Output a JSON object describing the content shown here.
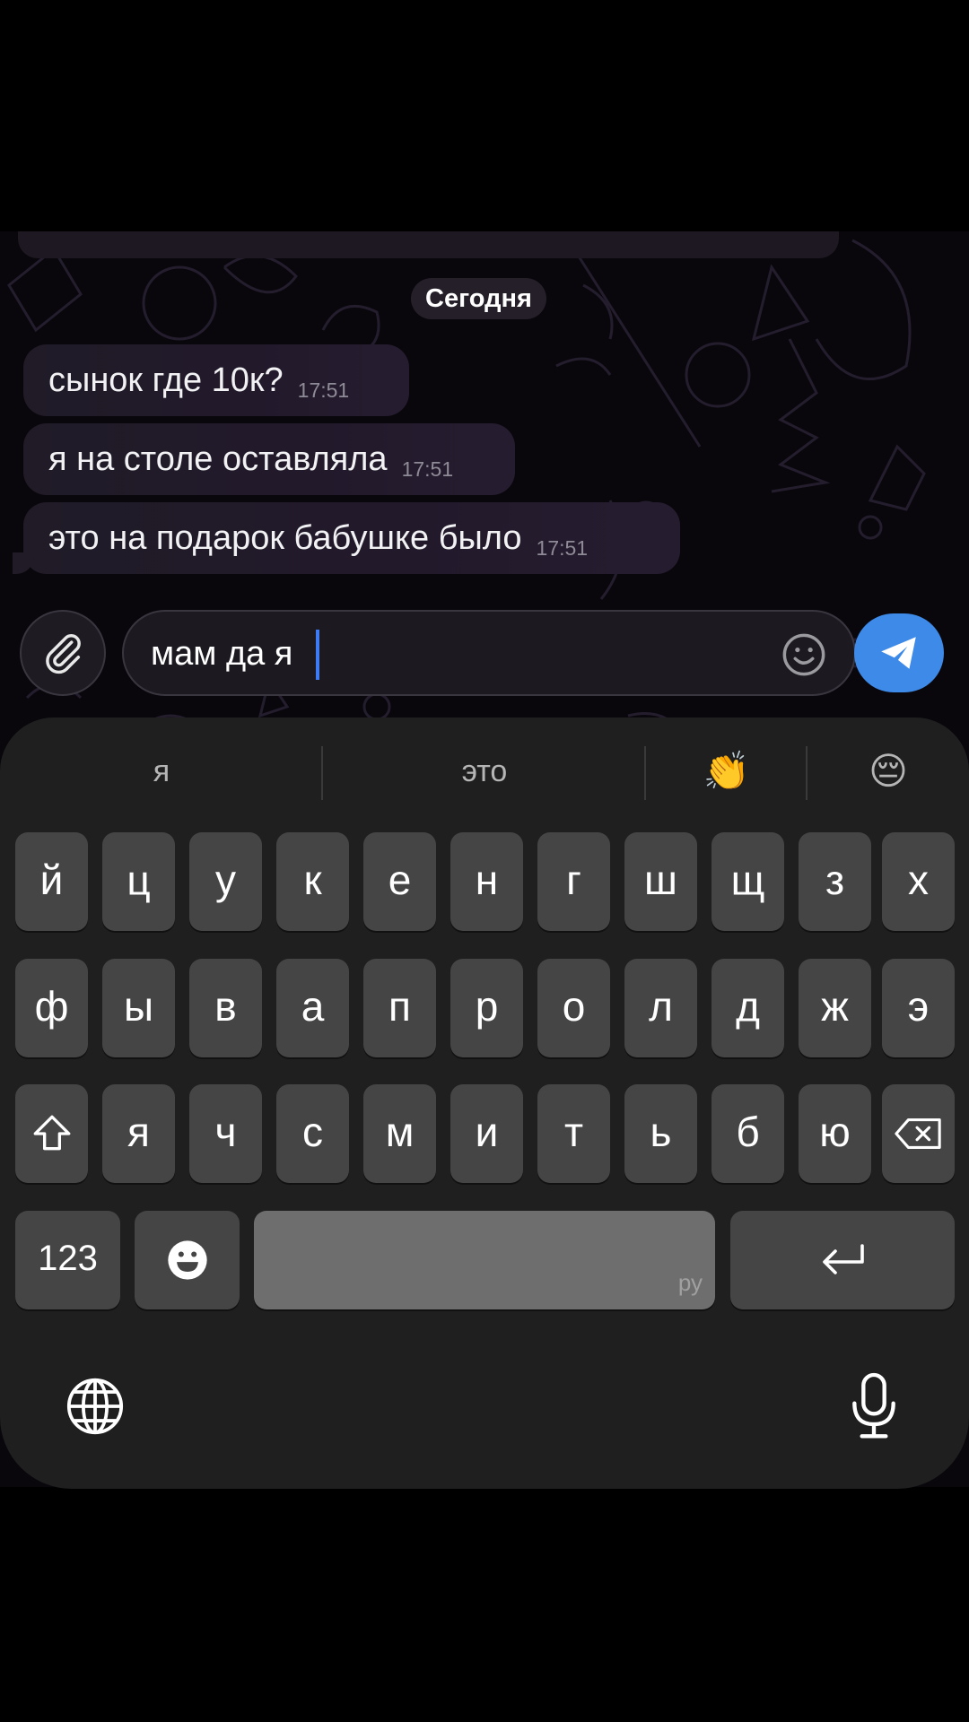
{
  "chat": {
    "date_separator": "Сегодня",
    "messages": [
      {
        "text": "сынок где 10к?",
        "time": "17:51"
      },
      {
        "text": "я на столе оставляла",
        "time": "17:51"
      },
      {
        "text": "это на подарок бабушке было",
        "time": "17:51"
      }
    ]
  },
  "composer": {
    "input_value": "мам да я",
    "attach_icon": "paperclip-icon",
    "emoji_icon": "smiley-icon",
    "send_icon": "paper-plane-icon",
    "send_color": "#3e8ae8"
  },
  "keyboard": {
    "suggestions": [
      "я",
      "это",
      "👏",
      "😔"
    ],
    "row1": [
      "й",
      "ц",
      "у",
      "к",
      "е",
      "н",
      "г",
      "ш",
      "щ",
      "з",
      "х"
    ],
    "row2": [
      "ф",
      "ы",
      "в",
      "а",
      "п",
      "р",
      "о",
      "л",
      "д",
      "ж",
      "э"
    ],
    "row3": [
      "я",
      "ч",
      "с",
      "м",
      "и",
      "т",
      "ь",
      "б",
      "ю"
    ],
    "numbers_label": "123",
    "space_language": "ру",
    "shift_icon": "shift-icon",
    "delete_icon": "backspace-icon",
    "return_icon": "return-icon",
    "emoji_icon": "emoji-keyboard-icon",
    "globe_icon": "globe-icon",
    "mic_icon": "microphone-icon"
  }
}
